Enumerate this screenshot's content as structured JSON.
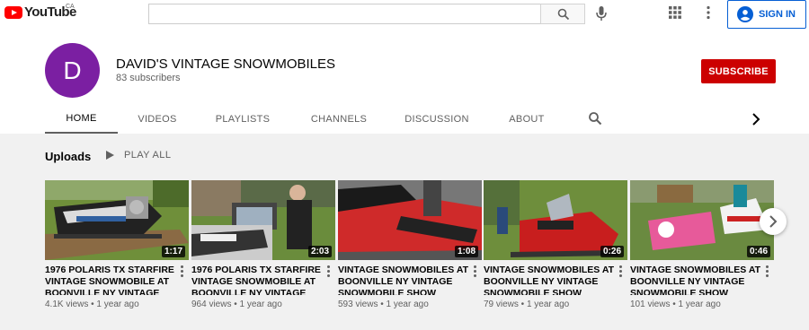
{
  "topbar": {
    "logo_text": "YouTube",
    "region": "CA",
    "search_placeholder": "",
    "sign_in_label": "SIGN IN",
    "icons": [
      "search-icon",
      "mic-icon",
      "apps-grid-icon",
      "more-vert-icon",
      "account-icon"
    ],
    "accent_color": "#065fd4"
  },
  "channel": {
    "avatar_letter": "D",
    "avatar_color": "#7b1fa2",
    "name": "DAVID'S VINTAGE SNOWMOBILES",
    "subscribers": "83 subscribers",
    "subscribe_label": "SUBSCRIBE",
    "subscribe_color": "#cc0000"
  },
  "tabs": [
    {
      "label": "HOME",
      "active": true
    },
    {
      "label": "VIDEOS",
      "active": false
    },
    {
      "label": "PLAYLISTS",
      "active": false
    },
    {
      "label": "CHANNELS",
      "active": false
    },
    {
      "label": "DISCUSSION",
      "active": false
    },
    {
      "label": "ABOUT",
      "active": false
    }
  ],
  "uploads": {
    "title": "Uploads",
    "play_all_label": "PLAY ALL",
    "videos": [
      {
        "title": "1976 POLARIS TX STARFIRE VINTAGE SNOWMOBILE AT BOONVILLE NY VINTAGE",
        "duration": "1:17",
        "views": "4.1K views",
        "age": "1 year ago"
      },
      {
        "title": "1976 POLARIS TX STARFIRE VINTAGE SNOWMOBILE AT BOONVILLE NY VINTAGE",
        "duration": "2:03",
        "views": "964 views",
        "age": "1 year ago"
      },
      {
        "title": "VINTAGE SNOWMOBILES AT BOONVILLE NY VINTAGE SNOWMOBILE SHOW",
        "duration": "1:08",
        "views": "593 views",
        "age": "1 year ago"
      },
      {
        "title": "VINTAGE SNOWMOBILES AT BOONVILLE NY VINTAGE SNOWMOBILE SHOW",
        "duration": "0:26",
        "views": "79 views",
        "age": "1 year ago"
      },
      {
        "title": "VINTAGE SNOWMOBILES AT BOONVILLE NY VINTAGE SNOWMOBILE SHOW",
        "duration": "0:46",
        "views": "101 views",
        "age": "1 year ago"
      }
    ]
  }
}
